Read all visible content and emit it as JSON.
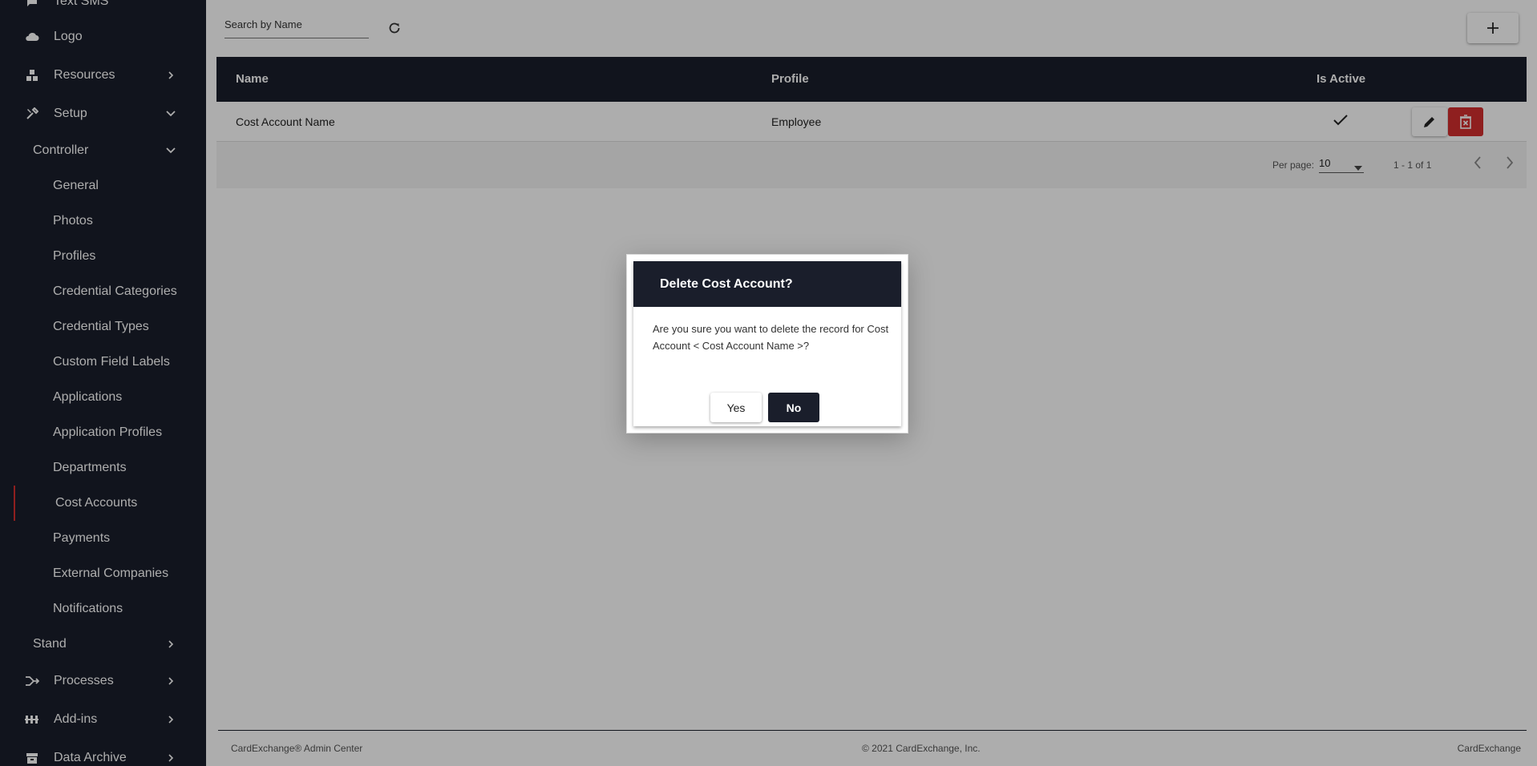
{
  "sidebar": {
    "text_sms": "Text SMS",
    "logo": "Logo",
    "resources": "Resources",
    "setup": "Setup",
    "controller": "Controller",
    "leaves": [
      "General",
      "Photos",
      "Profiles",
      "Credential Categories",
      "Credential Types",
      "Custom Field Labels",
      "Applications",
      "Application Profiles",
      "Departments"
    ],
    "active": "Cost Accounts",
    "leaves2": [
      "Payments",
      "External Companies",
      "Notifications"
    ],
    "stand": "Stand",
    "processes": "Processes",
    "addins": "Add-ins",
    "data_archive": "Data Archive"
  },
  "toolbar": {
    "search_placeholder": "Search by Name"
  },
  "table": {
    "headers": [
      "Name",
      "Profile",
      "Is Active"
    ],
    "rows": [
      {
        "name": "Cost Account Name",
        "profile": "Employee",
        "is_active": true
      }
    ]
  },
  "pager": {
    "per_page_label": "Per page:",
    "per_page_value": "10",
    "range": "1 - 1 of 1"
  },
  "footer": {
    "left": "CardExchange® Admin Center",
    "center": "© 2021 CardExchange, Inc.",
    "right": "CardExchange"
  },
  "dialog": {
    "title": "Delete Cost Account?",
    "message": "Are you sure you want to delete the record for Cost Account < Cost Account Name >?",
    "yes": "Yes",
    "no": "No"
  },
  "colors": {
    "dark": "#1a1e2b",
    "danger": "#d32f2f"
  }
}
